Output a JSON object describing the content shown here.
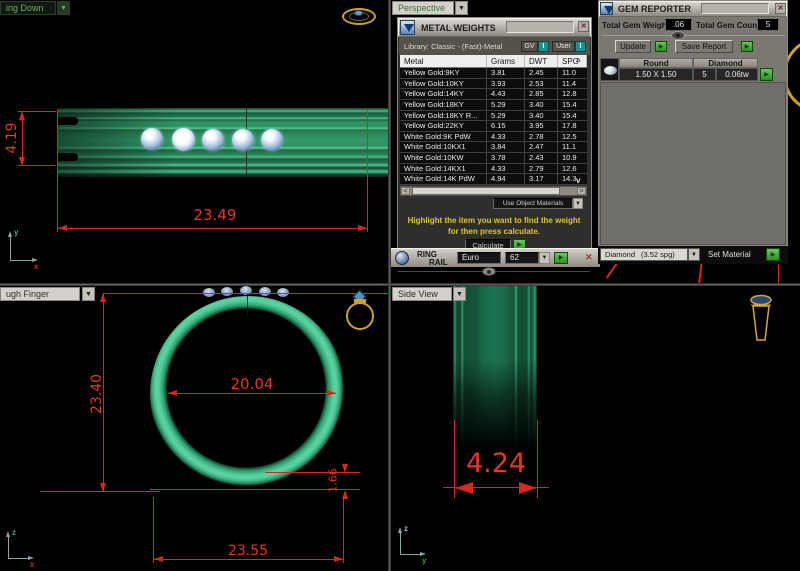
{
  "icons": {
    "dropdown": "▼",
    "close": "✕",
    "play": "▶",
    "scroll_up": "^",
    "scroll_down": "v",
    "scroll_left": "<",
    "scroll_right": ">"
  },
  "viewports": {
    "looking_down": {
      "label": "ing Down",
      "dim_height": "4.19",
      "dim_length": "23.49",
      "axis_v": "y",
      "axis_h": "x"
    },
    "perspective": {
      "label": "Perspective"
    },
    "through_finger": {
      "label": "ugh Finger",
      "dim_outer_height": "23.40",
      "dim_inner_diameter": "20.04",
      "dim_band_thickness": "1.66",
      "dim_outer_width": "23.55",
      "axis_v": "z",
      "axis_h": "x"
    },
    "side_view": {
      "label": "Side View",
      "dim_band_width": "4.24",
      "axis_v": "z",
      "axis_h": "y"
    }
  },
  "metal_weights": {
    "title": "METAL WEIGHTS",
    "library_label": "Library: Classic - (Fast)-Metal",
    "toggle_gv": "GV",
    "toggle_user": "User",
    "columns": [
      "Metal",
      "Grams",
      "DWT",
      "SPG"
    ],
    "rows": [
      [
        "Yellow Gold:9KY",
        "3.81",
        "2.45",
        "11.0"
      ],
      [
        "Yellow Gold:10KY",
        "3.93",
        "2.53",
        "11.4"
      ],
      [
        "Yellow Gold:14KY",
        "4.43",
        "2.85",
        "12.8"
      ],
      [
        "Yellow Gold:18KY",
        "5.29",
        "3.40",
        "15.4"
      ],
      [
        "Yellow Gold:18KY R...",
        "5.29",
        "3.40",
        "15.4"
      ],
      [
        "Yellow Gold:22KY",
        "6.15",
        "3.95",
        "17.8"
      ],
      [
        "White Gold:9K PdW",
        "4.33",
        "2.78",
        "12.5"
      ],
      [
        "White Gold:10KX1",
        "3.84",
        "2.47",
        "11.1"
      ],
      [
        "White Gold:10KW",
        "3.78",
        "2.43",
        "10.9"
      ],
      [
        "White Gold:14KX1",
        "4.33",
        "2.79",
        "12.6"
      ],
      [
        "White Gold:14K PdW",
        "4.94",
        "3.17",
        "14.3"
      ]
    ],
    "materials_dropdown": "Use Object Materials",
    "instruction_line1": "Highlight the item you want to find the weight",
    "instruction_line2": "for then press calculate.",
    "calculate_label": "Calculate"
  },
  "ring_rail": {
    "line1": "RING",
    "line2": "RAIL",
    "currency": "Euro",
    "size": "62"
  },
  "gem_reporter": {
    "title": "GEM REPORTER",
    "total_weight_label": "Total Gem Weight",
    "total_weight_value": ".06",
    "total_count_label": "Total Gem Count",
    "total_count_value": "5",
    "update_label": "Update",
    "save_label": "Save Report",
    "gem_shape": "Round",
    "gem_type": "Diamond",
    "gem_size": "1.50 X 1.50",
    "gem_count": "5",
    "gem_weight": "0.06tw",
    "material_name": "Diamond",
    "material_spg": "(3.52 spg)",
    "set_material_label": "Set Material"
  },
  "colors": {
    "dimension_red": "#d8281c",
    "band_green": "#2e9463",
    "ring_green": "#53cb9b",
    "gold": "#c9a22a",
    "play_green": "#3aa02a",
    "instruction_yellow": "#e2c430"
  }
}
